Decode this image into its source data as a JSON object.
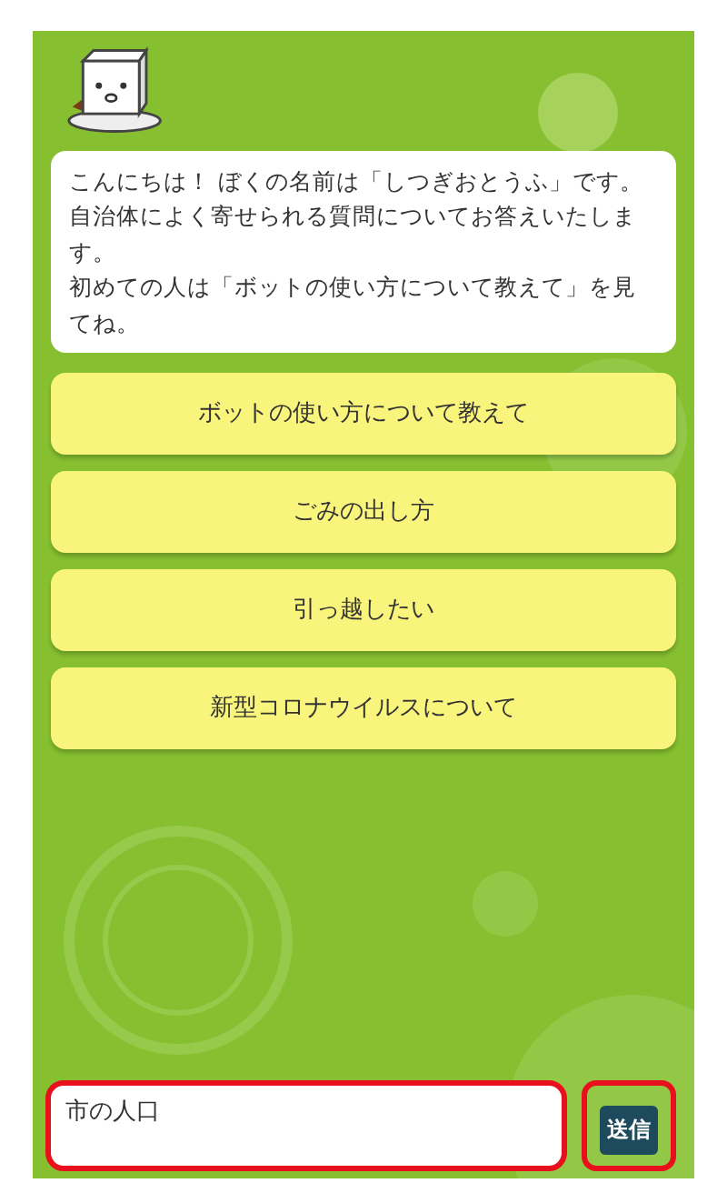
{
  "greeting": {
    "paragraphs": [
      "こんにちは！ ぼくの名前は「しつぎおとうふ」です。自治体によく寄せられる質問についてお答えいたします。",
      "初めての人は「ボットの使い方について教えて」を見てね。"
    ]
  },
  "suggestions": [
    {
      "label": "ボットの使い方について教えて"
    },
    {
      "label": "ごみの出し方"
    },
    {
      "label": "引っ越したい"
    },
    {
      "label": "新型コロナウイルスについて"
    }
  ],
  "message_input": {
    "value": "市の人口",
    "highlighted": true
  },
  "send_button": {
    "label": "送信",
    "highlighted": true
  }
}
